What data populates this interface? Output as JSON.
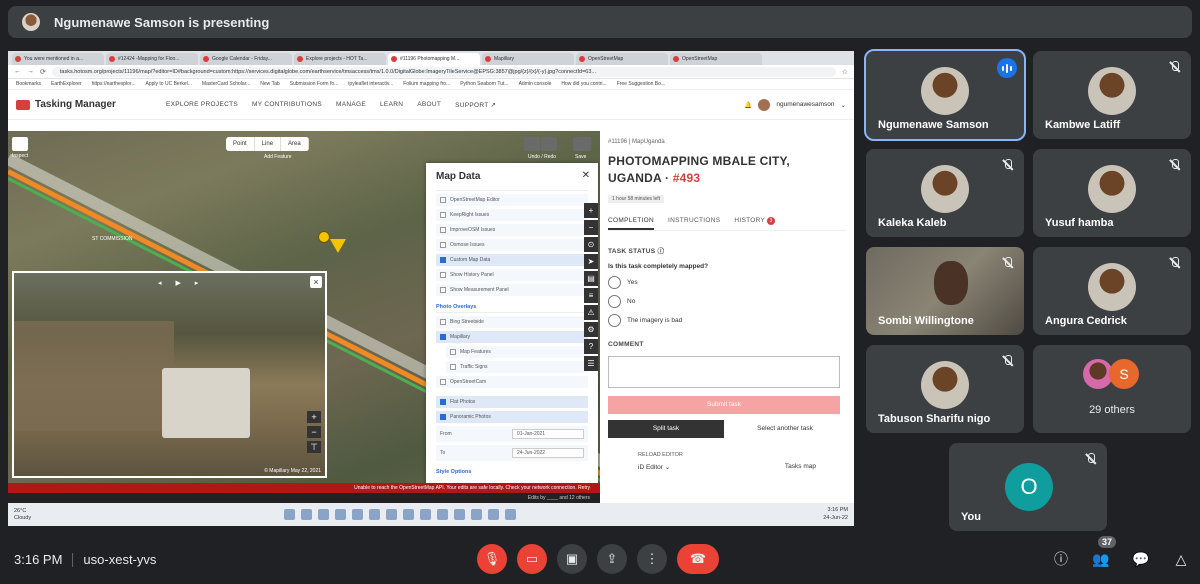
{
  "presenter": {
    "text": "Ngumenawe Samson is presenting"
  },
  "browser": {
    "tabs": [
      "You were mentioned in a...",
      "#12424 -Mapping for Floo...",
      "Google Calendar - Friday...",
      "Explore projects - HOT Ta...",
      "#11196 Photomapping M...",
      "Mapillary",
      "OpenStreetMap",
      "OpenStreetMap"
    ],
    "url": "tasks.hotosm.org/projects/11196/map/?editor=ID#background=custom:https://services.digitalglobe.com/earthservice/tmsaccess/tms/1.0.0/DigitalGlobe:ImageryTileService@EPSG:3857@jpg/{z}/{x}/{-y}.jpg?connectId=63...",
    "bookmarks": [
      "Bookmarks",
      "EarthExplorer",
      "https://earthexplor...",
      "Apply to UC Berkel...",
      "MasterCard Scholar...",
      "New Tab",
      "Submission Form fo...",
      "ipyleaflet interactiv...",
      "Folium mapping fro...",
      "Python Seaborn Tut...",
      "Admin console",
      "How did you contri...",
      "Free Suggestion Bo..."
    ]
  },
  "tasking_manager": {
    "logo": "Tasking Manager",
    "nav": [
      "EXPLORE PROJECTS",
      "MY CONTRIBUTIONS",
      "MANAGE",
      "LEARN",
      "ABOUT",
      "SUPPORT ↗"
    ],
    "user": "ngumenawesamson"
  },
  "editor": {
    "inspect_label": "Inspect",
    "add_feature_buttons": [
      "Point",
      "Line",
      "Area"
    ],
    "add_feature_label": "Add Feature",
    "undo_label": "Undo / Redo",
    "save_label": "Save",
    "poi_label": "ST COMMISSION"
  },
  "photo_viewer": {
    "controls": "◂ ▶ ▸",
    "credit": "© Mapillary May 22, 2021"
  },
  "map_data": {
    "title": "Map Data",
    "data_layers": [
      {
        "label": "OpenStreetMap Editor",
        "checked": false
      },
      {
        "label": "KeepRight Issues",
        "checked": false
      },
      {
        "label": "ImproveOSM Issues",
        "checked": false
      },
      {
        "label": "Osmose Issues",
        "checked": false
      },
      {
        "label": "Custom Map Data",
        "checked": true
      },
      {
        "label": "Show History Panel",
        "checked": false
      },
      {
        "label": "Show Measurement Panel",
        "checked": false
      }
    ],
    "photo_heading": "Photo Overlays",
    "photo_layers": [
      {
        "label": "Bing Streetside",
        "checked": false,
        "sub": false
      },
      {
        "label": "Mapillary",
        "checked": true,
        "sub": false
      },
      {
        "label": "Map Features",
        "checked": false,
        "sub": true
      },
      {
        "label": "Traffic Signs",
        "checked": false,
        "sub": true
      },
      {
        "label": "OpenStreetCam",
        "checked": false,
        "sub": false
      }
    ],
    "photo_types": [
      {
        "label": "Flat Photos",
        "checked": true
      },
      {
        "label": "Panoramic Photos",
        "checked": true
      }
    ],
    "from_label": "From",
    "from_value": "01-Jan-2021",
    "to_label": "To",
    "to_value": "24-Jun-2022",
    "more": "Style Options"
  },
  "status_bar": "Unable to reach the OpenStreetMap API. Your edits are safe locally. Check your network connection. Retry",
  "footer_bar": "Edits by ____ and 12 others",
  "task": {
    "crumb": "#11196 | MapUganda",
    "title": "PHOTOMAPPING MBALE CITY, UGANDA ·",
    "number": "#493",
    "timer": "1 hour 58 minutes left",
    "tabs": [
      "COMPLETION",
      "INSTRUCTIONS",
      "HISTORY"
    ],
    "history_badge": "3",
    "status_heading": "TASK STATUS",
    "question": "Is this task completely mapped?",
    "options": [
      "Yes",
      "No",
      "The imagery is bad"
    ],
    "comment_heading": "COMMENT",
    "submit": "Submit task",
    "split": "Split task",
    "select_another": "Select another task",
    "reload": "RELOAD EDITOR",
    "editor_select": "iD Editor",
    "tasks_map": "Tasks map"
  },
  "taskbar": {
    "weather_temp": "26°C",
    "weather_desc": "Cloudy",
    "time": "3:16 PM",
    "date": "24-Jun-22"
  },
  "participants": [
    {
      "name": "Ngumenawe Samson",
      "speaking": true
    },
    {
      "name": "Kambwe Latiff",
      "muted": true
    },
    {
      "name": "Kaleka Kaleb",
      "muted": true
    },
    {
      "name": "Yusuf hamba",
      "muted": true
    },
    {
      "name": "Sombi Willingtone",
      "muted": true
    },
    {
      "name": "Angura Cedrick",
      "muted": true
    },
    {
      "name": "Tabuson Sharifu nigo",
      "muted": true
    },
    {
      "name": "29 others",
      "initial": "S"
    },
    {
      "name": "You",
      "initial": "O",
      "muted": true
    }
  ],
  "meeting": {
    "time": "3:16 PM",
    "code": "uso-xest-yvs",
    "participant_count": "37"
  },
  "colors": {
    "accent": "#8ab4f8",
    "end_call": "#ea4335",
    "tm_red": "#d73f3f"
  }
}
